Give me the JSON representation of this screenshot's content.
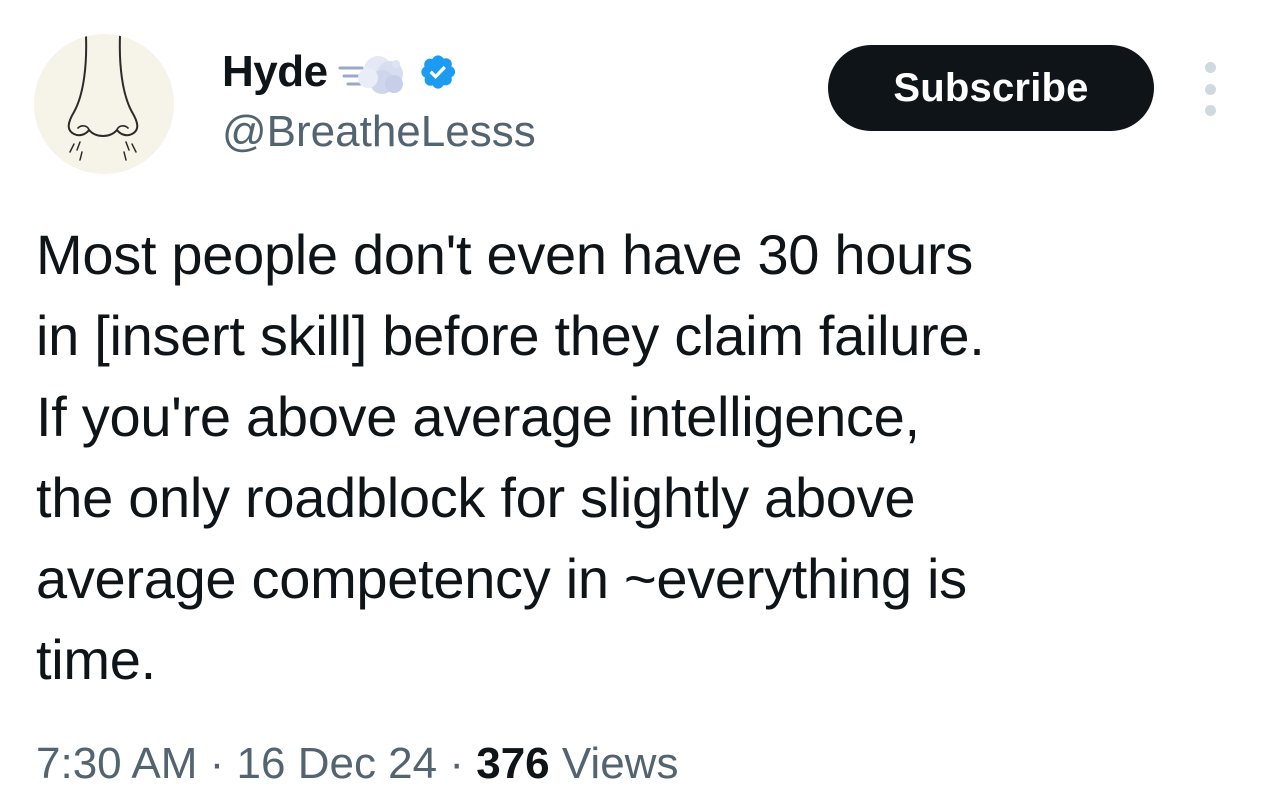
{
  "author": {
    "display_name": "Hyde",
    "handle": "@BreatheLesss",
    "verified": true,
    "avatar_icon": "nose-drawing-icon",
    "name_emoji_icon": "cloud-wind-icon",
    "badge_icon": "verified-badge-icon",
    "badge_color": "#1d9bf0"
  },
  "actions": {
    "subscribe_label": "Subscribe",
    "more_icon": "vertical-ellipsis-icon"
  },
  "tweet": {
    "text": "Most people don't even have 30 hours\nin [insert skill] before they claim failure.\nIf you're above average intelligence,\nthe only roadblock for slightly above\naverage competency in ~everything is\ntime."
  },
  "meta": {
    "time": "7:30 AM",
    "separator": " · ",
    "date": "16 Dec 24",
    "views_count": "376",
    "views_label": " Views"
  },
  "colors": {
    "text_primary": "#0f1419",
    "text_secondary": "#536471",
    "button_bg": "#0f1419",
    "button_text": "#ffffff",
    "avatar_bg": "#f6f3e8"
  }
}
